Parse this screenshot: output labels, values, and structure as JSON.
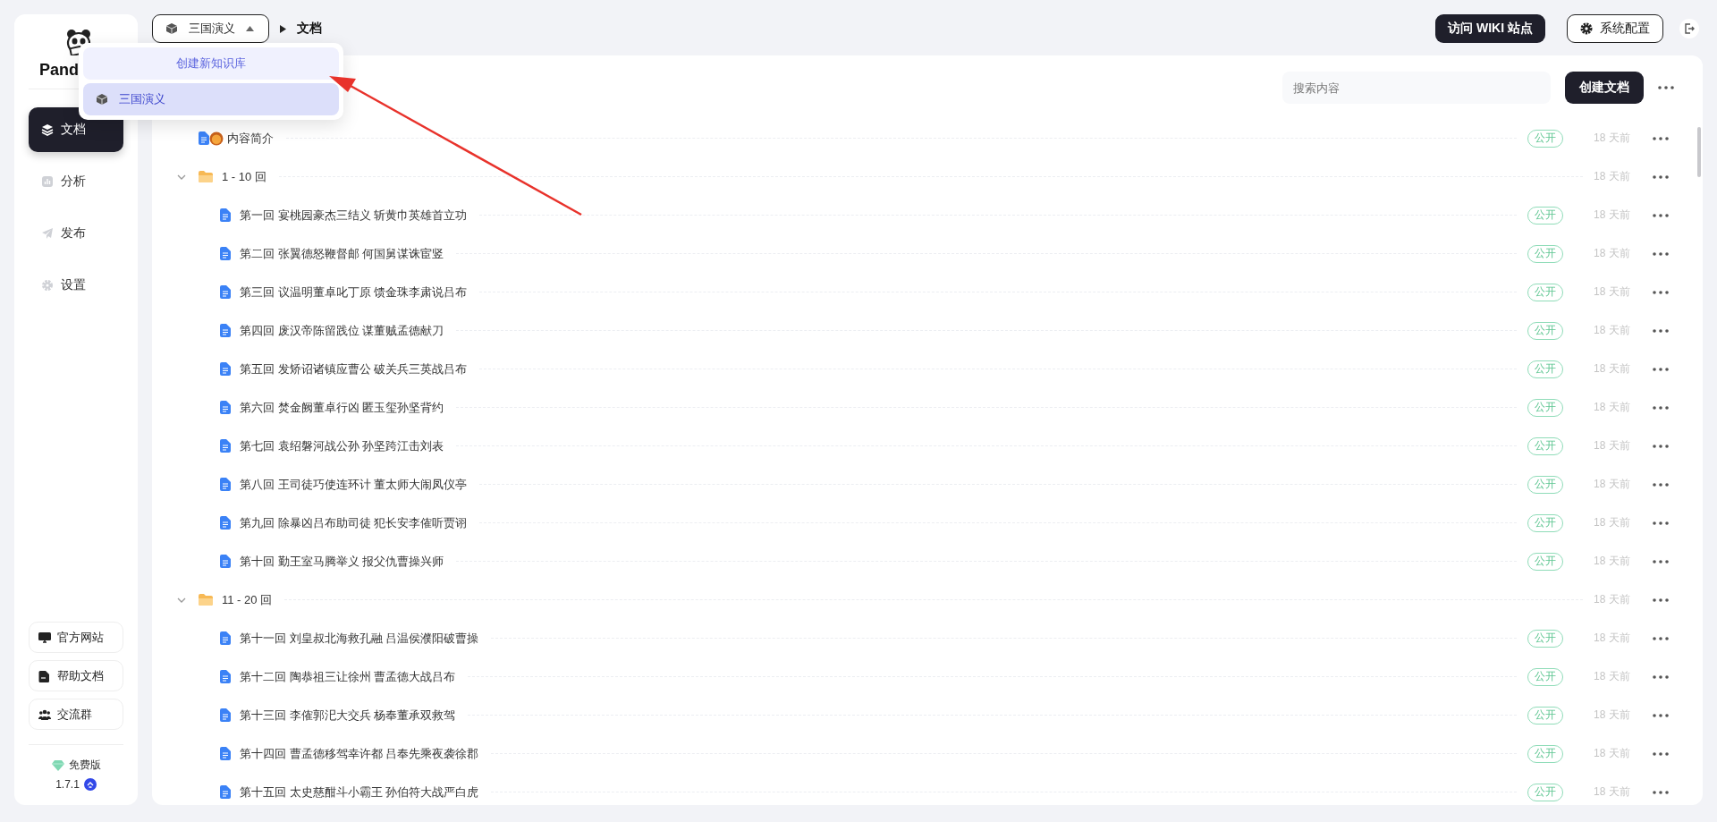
{
  "sidebar": {
    "logo_text": "Pand",
    "nav": [
      {
        "label": "文档",
        "selected": true
      },
      {
        "label": "分析",
        "selected": false
      },
      {
        "label": "发布",
        "selected": false
      },
      {
        "label": "设置",
        "selected": false
      }
    ],
    "links": [
      "官方网站",
      "帮助文档",
      "交流群"
    ],
    "edition": "免费版",
    "version": "1.7.1"
  },
  "topbar": {
    "kb_selector": {
      "label": "三国演义",
      "open": true
    },
    "breadcrumb": "文档",
    "buttons": [
      {
        "label": "访问 WIKI 站点",
        "kind": "primary"
      },
      {
        "label": "系统配置",
        "kind": "outline"
      }
    ]
  },
  "kb_menu": {
    "items": [
      {
        "kind": "action",
        "label": "创建新知识库",
        "selected": false
      },
      {
        "kind": "kb",
        "label": "三国演义",
        "selected": true
      }
    ]
  },
  "toolbar": {
    "search": {
      "placeholder": "搜索内容"
    },
    "create_button": "创建文档"
  },
  "tree": [
    {
      "kind": "doc",
      "title": "内容简介",
      "has_emoji": true,
      "badge": "公开",
      "time": "18 天前"
    },
    {
      "kind": "folder",
      "title": "1 - 10 回",
      "expanded": true,
      "time": "18 天前",
      "children": [
        {
          "kind": "doc",
          "title": "第一回 宴桃园豪杰三结义 斩黄巾英雄首立功",
          "badge": "公开",
          "time": "18 天前"
        },
        {
          "kind": "doc",
          "title": "第二回 张翼德怒鞭督邮 何国舅谋诛宦竖",
          "badge": "公开",
          "time": "18 天前"
        },
        {
          "kind": "doc",
          "title": "第三回 议温明董卓叱丁原 馈金珠李肃说吕布",
          "badge": "公开",
          "time": "18 天前"
        },
        {
          "kind": "doc",
          "title": "第四回 废汉帝陈留践位 谋董贼孟德献刀",
          "badge": "公开",
          "time": "18 天前"
        },
        {
          "kind": "doc",
          "title": "第五回 发矫诏诸镇应曹公 破关兵三英战吕布",
          "badge": "公开",
          "time": "18 天前"
        },
        {
          "kind": "doc",
          "title": "第六回 焚金阙董卓行凶 匿玉玺孙坚背约",
          "badge": "公开",
          "time": "18 天前"
        },
        {
          "kind": "doc",
          "title": "第七回 袁绍磐河战公孙 孙坚跨江击刘表",
          "badge": "公开",
          "time": "18 天前"
        },
        {
          "kind": "doc",
          "title": "第八回 王司徒巧使连环计 董太师大闹凤仪亭",
          "badge": "公开",
          "time": "18 天前"
        },
        {
          "kind": "doc",
          "title": "第九回 除暴凶吕布助司徒 犯长安李傕听贾诩",
          "badge": "公开",
          "time": "18 天前"
        },
        {
          "kind": "doc",
          "title": "第十回 勤王室马腾举义 报父仇曹操兴师",
          "badge": "公开",
          "time": "18 天前"
        }
      ]
    },
    {
      "kind": "folder",
      "title": "11 - 20 回",
      "expanded": true,
      "time": "18 天前",
      "children": [
        {
          "kind": "doc",
          "title": "第十一回 刘皇叔北海救孔融 吕温侯濮阳破曹操",
          "badge": "公开",
          "time": "18 天前"
        },
        {
          "kind": "doc",
          "title": "第十二回 陶恭祖三让徐州 曹孟德大战吕布",
          "badge": "公开",
          "time": "18 天前"
        },
        {
          "kind": "doc",
          "title": "第十三回 李傕郭汜大交兵 杨奉董承双救驾",
          "badge": "公开",
          "time": "18 天前"
        },
        {
          "kind": "doc",
          "title": "第十四回 曹孟德移驾幸许都 吕奉先乘夜袭徐郡",
          "badge": "公开",
          "time": "18 天前"
        },
        {
          "kind": "doc",
          "title": "第十五回 太史慈酣斗小霸王 孙伯符大战严白虎",
          "badge": "公开",
          "time": "18 天前"
        }
      ]
    }
  ]
}
